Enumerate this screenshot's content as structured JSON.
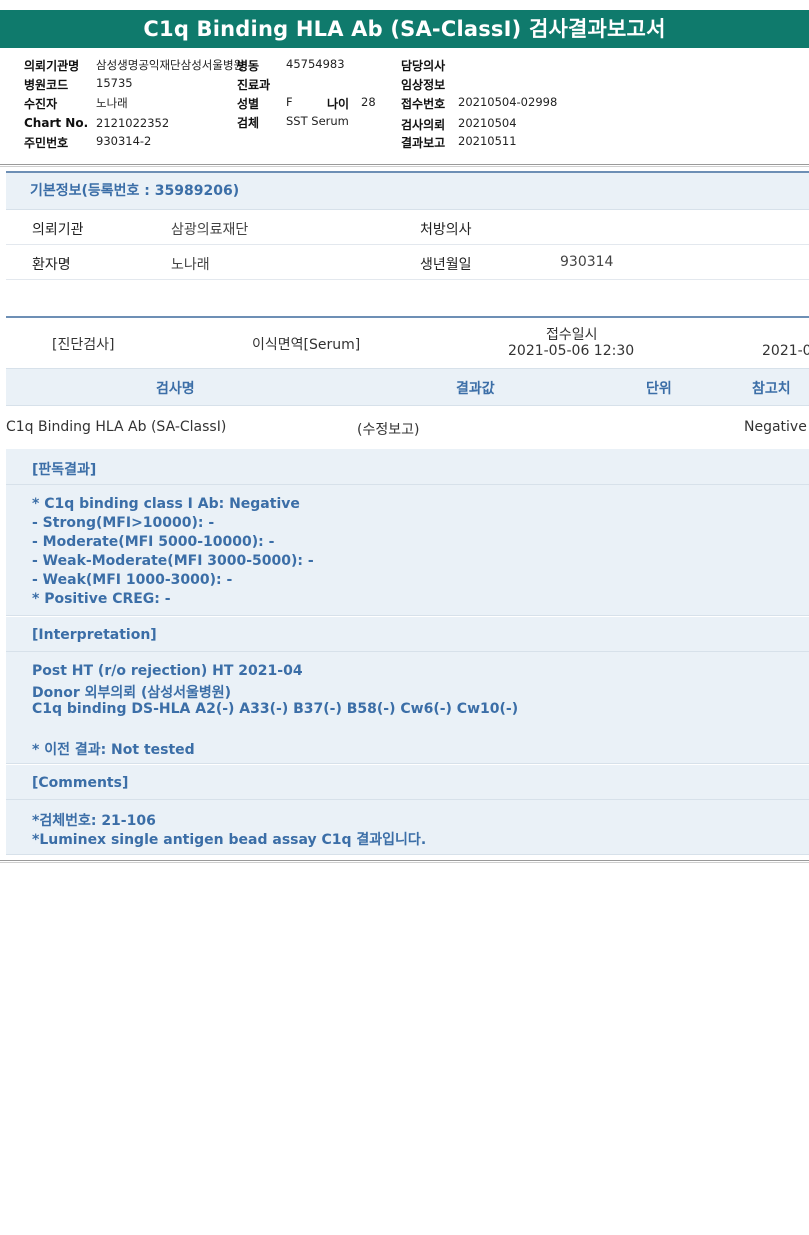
{
  "title": "C1q Binding HLA Ab (SA-ClassI) 검사결과보고서",
  "header": {
    "left": [
      {
        "label": "의뢰기관명",
        "value": "삼성생명공익재단삼성서울병원"
      },
      {
        "label": "병원코드",
        "value": "15735"
      },
      {
        "label": "수진자",
        "value": "노나래"
      },
      {
        "label": "Chart No.",
        "value": "2121022352"
      },
      {
        "label": "주민번호",
        "value": "930314-2"
      }
    ],
    "middle": {
      "ward_label": "병동",
      "ward_value": "45754983",
      "dept_label": "진료과",
      "sex_label": "성별",
      "sex_value": "F",
      "age_label": "나이",
      "age_value": "28",
      "specimen_label": "검체",
      "specimen_value": "SST Serum"
    },
    "right": [
      {
        "label": "담당의사",
        "value": ""
      },
      {
        "label": "임상정보",
        "value": ""
      },
      {
        "label": "접수번호",
        "value": "20210504-02998"
      },
      {
        "label": "검사의뢰",
        "value": "20210504"
      },
      {
        "label": "결과보고",
        "value": "20210511"
      }
    ]
  },
  "basic": {
    "title": "기본정보(등록번호 : 35989206)",
    "inst_label": "의뢰기관",
    "inst_value": "삼광의료재단",
    "doctor_label": "처방의사",
    "doctor_value": "",
    "patient_label": "환자명",
    "patient_value": "노나래",
    "birth_label": "생년월일",
    "birth_value": "930314"
  },
  "exam": {
    "category": "[진단검사]",
    "subcategory": "이식면역[Serum]",
    "received_label": "접수일시",
    "received_value": "2021-05-06  12:30",
    "truncated_value": "2021-0"
  },
  "table": {
    "headers": [
      "검사명",
      "결과값",
      "단위",
      "참고치"
    ],
    "row": {
      "name": "C1q Binding HLA Ab (SA-ClassI)",
      "result": "(수정보고)",
      "unit": "",
      "reference": "Negative"
    }
  },
  "judgement": {
    "title": "[판독결과]",
    "lines": [
      "* C1q binding class I Ab: Negative",
      "- Strong(MFI>10000): -",
      "- Moderate(MFI 5000-10000): -",
      "- Weak-Moderate(MFI 3000-5000): -",
      "- Weak(MFI 1000-3000): -",
      "* Positive CREG: -"
    ]
  },
  "interpretation": {
    "title": "[Interpretation]",
    "lines": [
      "Post HT (r/o rejection) HT 2021-04",
      "Donor 외부의뢰 (삼성서울병원)",
      "C1q binding DS-HLA A2(-) A33(-) B37(-) B58(-) Cw6(-) Cw10(-)",
      "",
      "* 이전 결과: Not tested"
    ]
  },
  "comments": {
    "title": "[Comments]",
    "lines": [
      "*검체번호: 21-106",
      "*Luminex single antigen bead assay C1q 결과입니다."
    ]
  }
}
